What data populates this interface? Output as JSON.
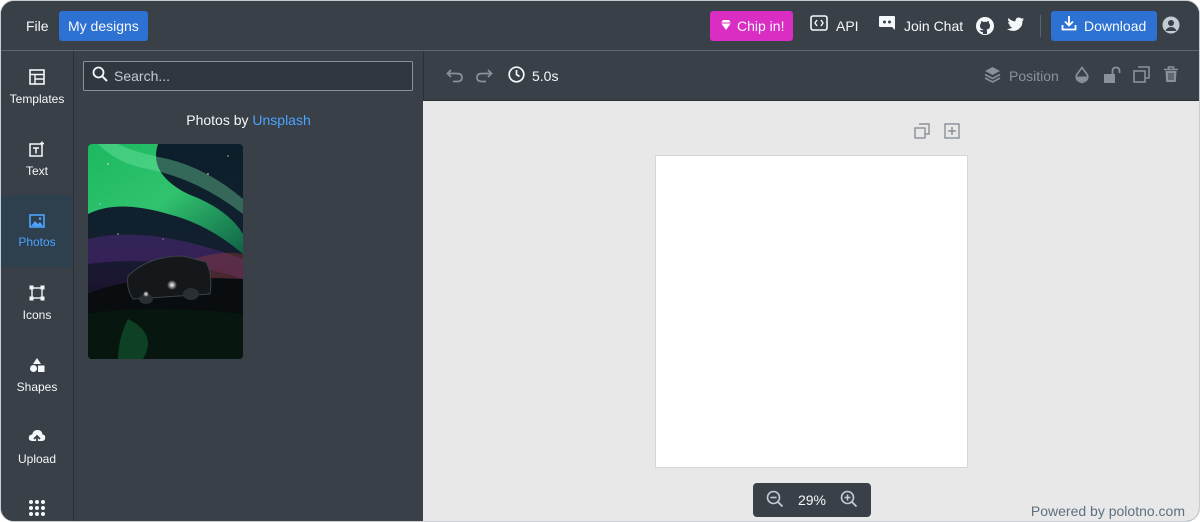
{
  "navbar": {
    "file_label": "File",
    "my_designs_label": "My designs",
    "chip_in_label": "Chip in!",
    "api_label": "API",
    "join_chat_label": "Join Chat",
    "download_label": "Download"
  },
  "sidebar": {
    "tabs": [
      {
        "label": "Templates",
        "icon": "templates-icon"
      },
      {
        "label": "Text",
        "icon": "text-icon"
      },
      {
        "label": "Photos",
        "icon": "photos-icon",
        "active": true
      },
      {
        "label": "Icons",
        "icon": "icons-icon"
      },
      {
        "label": "Shapes",
        "icon": "shapes-icon"
      },
      {
        "label": "Upload",
        "icon": "upload-icon"
      }
    ]
  },
  "panel": {
    "search_placeholder": "Search...",
    "credit_prefix": "Photos by",
    "credit_link": "Unsplash"
  },
  "toolbar": {
    "duration": "5.0s",
    "position_label": "Position"
  },
  "workspace": {
    "zoom": "29%",
    "powered_by": "Powered by polotno.com"
  },
  "colors": {
    "navbar_bg": "#394048",
    "primary_blue": "#2d72d2",
    "chip_in_pink": "#d92dc4",
    "active_tab_text": "#4ba3ff",
    "canvas_bg": "#e8e8e8"
  }
}
